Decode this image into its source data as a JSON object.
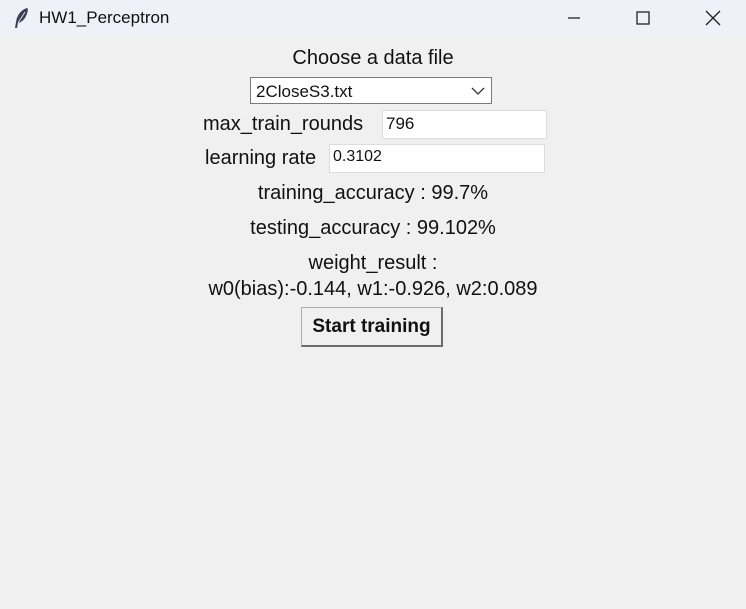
{
  "window": {
    "title": "HW1_Perceptron"
  },
  "form": {
    "choose_label": "Choose a data file",
    "data_file_selected": "2CloseS3.txt",
    "max_rounds_label": "max_train_rounds",
    "max_rounds_value": "796",
    "learning_rate_label": "learning rate",
    "learning_rate_value": "0.3102",
    "training_accuracy": "training_accuracy : 99.7%",
    "testing_accuracy": "testing_accuracy : 99.102%",
    "weight_result_label": "weight_result :",
    "weight_result_value": "w0(bias):-0.144, w1:-0.926, w2:0.089",
    "start_button_label": "Start training"
  }
}
